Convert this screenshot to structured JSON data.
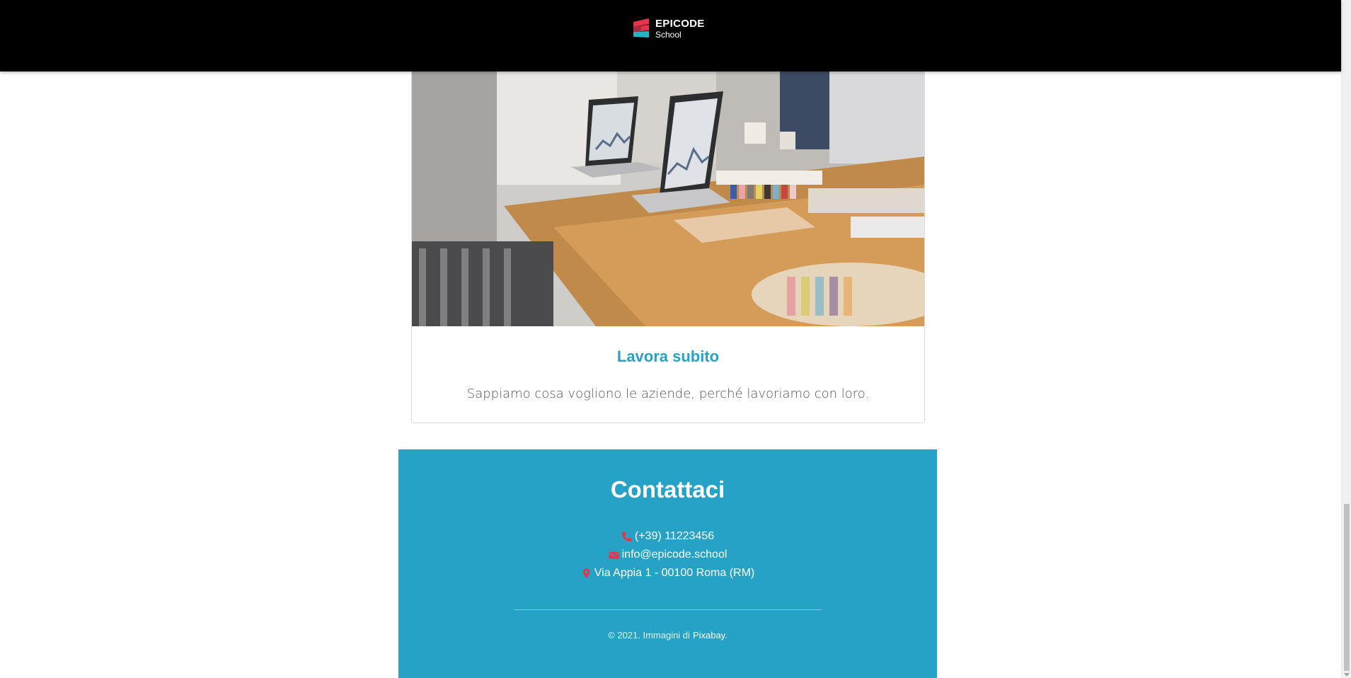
{
  "brand": {
    "name": "EPICODE",
    "sub": "School",
    "colors": {
      "red": "#e8344b",
      "teal": "#25b4c6",
      "footer_bg": "#25a2c6",
      "accent_title": "#27a2c6"
    }
  },
  "card": {
    "image_alt": "people working with laptops at a table",
    "title": "Lavora subito",
    "text": "Sappiamo cosa vogliono le aziende, perché lavoriamo con loro."
  },
  "footer": {
    "title": "Contattaci",
    "phone": "(+39) 11223456",
    "email": "info@epicode.school",
    "address": "Via Appia 1 - 00100 Roma (RM)",
    "copyright_prefix": "© 2021. Immagini di",
    "copyright_link": "Pixabay",
    "copyright_suffix": "."
  },
  "icons": {
    "phone": "phone-icon",
    "email": "envelope-icon",
    "address": "map-marker-icon"
  }
}
